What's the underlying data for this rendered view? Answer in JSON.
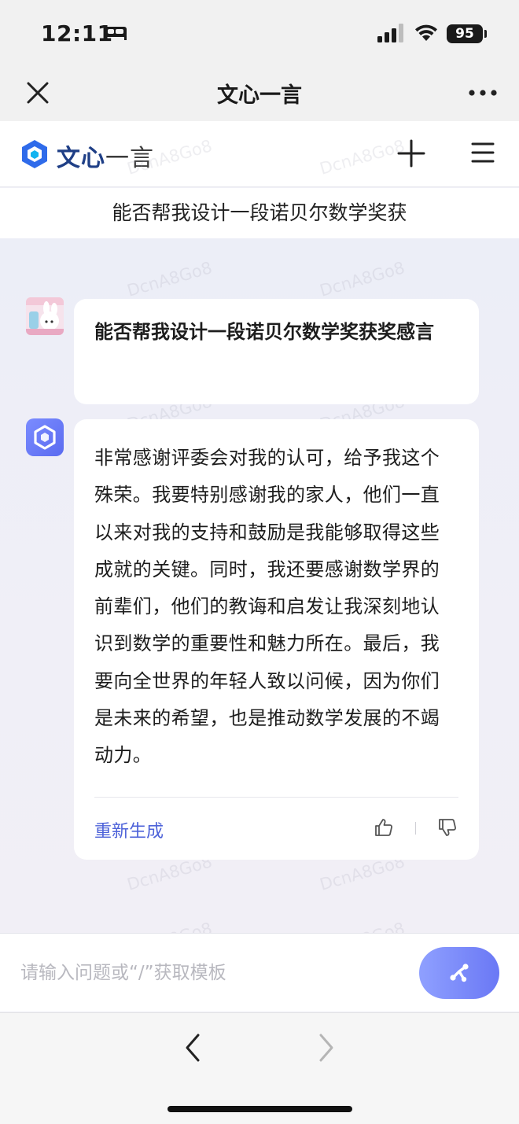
{
  "status_bar": {
    "time": "12:11",
    "battery": "95"
  },
  "wechat_bar": {
    "title": "文心一言"
  },
  "app_header": {
    "logo_bold": "文心",
    "logo_light": "一言"
  },
  "conversation": {
    "title": "能否帮我设计一段诺贝尔数学奖获"
  },
  "messages": [
    {
      "role": "user",
      "text": "能否帮我设计一段诺贝尔数学奖获奖感言"
    },
    {
      "role": "assistant",
      "text": "非常感谢评委会对我的认可，给予我这个殊荣。我要特别感谢我的家人，他们一直以来对我的支持和鼓励是我能够取得这些成就的关键。同时，我还要感谢数学界的前辈们，他们的教诲和启发让我深刻地认识到数学的重要性和魅力所在。最后，我要向全世界的年轻人致以问候，因为你们是未来的希望，也是推动数学发展的不竭动力。"
    }
  ],
  "actions": {
    "regenerate": "重新生成"
  },
  "input": {
    "placeholder": "请输入问题或“/”获取模板"
  },
  "watermark": "DcnA8Go8",
  "colors": {
    "accent": "#4d62d9",
    "brand": "#1f3f86",
    "send_gradient_start": "#8fa0ff",
    "send_gradient_end": "#6a78f5"
  },
  "icons": {
    "close": "close-icon",
    "more": "more-icon",
    "plus": "plus-icon",
    "menu": "menu-icon",
    "thumb_up": "thumb-up-icon",
    "thumb_down": "thumb-down-icon",
    "send": "send-icon",
    "back": "chevron-left-icon",
    "forward": "chevron-right-icon"
  }
}
